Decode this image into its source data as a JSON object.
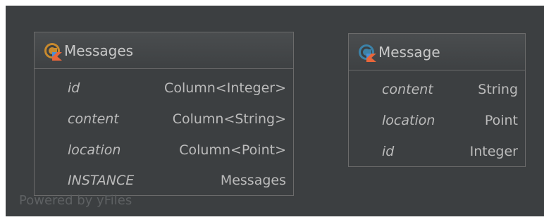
{
  "diagram": {
    "background_color": "#3c3f41",
    "border_color": "#6b6b6b",
    "text_color": "#bbbbbb",
    "watermark": "Powered by yFiles",
    "nodes": [
      {
        "title": "Messages",
        "icon": "kotlin-object-icon",
        "icon_color": "#c88a2e",
        "members": [
          {
            "name": "id",
            "type": "Column<Integer>"
          },
          {
            "name": "content",
            "type": "Column<String>"
          },
          {
            "name": "location",
            "type": "Column<Point>"
          },
          {
            "name": "INSTANCE",
            "type": "Messages"
          }
        ]
      },
      {
        "title": "Message",
        "icon": "kotlin-class-icon",
        "icon_color": "#3c82a8",
        "members": [
          {
            "name": "content",
            "type": "String"
          },
          {
            "name": "location",
            "type": "Point"
          },
          {
            "name": "id",
            "type": "Integer"
          }
        ]
      }
    ]
  }
}
